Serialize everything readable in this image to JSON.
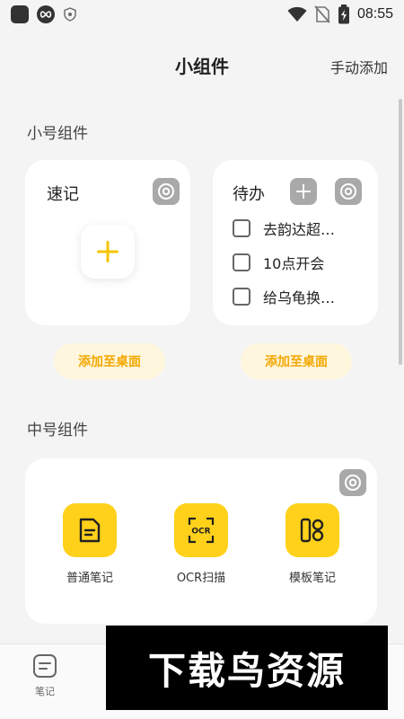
{
  "status_bar": {
    "time": "08:55",
    "icons": [
      "app-icon",
      "infinity-icon",
      "shield-icon",
      "wifi-icon",
      "no-sim-icon",
      "battery-charging-icon"
    ]
  },
  "header": {
    "title": "小组件",
    "manual_add_label": "手动添加"
  },
  "small_section": {
    "title": "小号组件",
    "quick_note_card": {
      "title": "速记",
      "icons": [
        "settings-icon",
        "plus-icon"
      ],
      "add_button_label": "添加至桌面"
    },
    "todo_card": {
      "title": "待办",
      "icons": [
        "plus-icon",
        "settings-icon"
      ],
      "items": [
        {
          "text": "去韵达超…",
          "checked": false
        },
        {
          "text": "10点开会",
          "checked": false
        },
        {
          "text": "给乌龟换…",
          "checked": false
        }
      ],
      "add_button_label": "添加至桌面"
    }
  },
  "medium_section": {
    "title": "中号组件",
    "tools": [
      {
        "label": "普通笔记",
        "icon": "note-icon"
      },
      {
        "label": "OCR扫描",
        "icon": "ocr-scan-icon"
      },
      {
        "label": "模板笔记",
        "icon": "template-icon"
      }
    ],
    "icon_text": {
      "ocr": "OCR"
    }
  },
  "bottom_nav": {
    "items": [
      {
        "label": "笔记",
        "icon": "note-tab-icon"
      }
    ]
  },
  "watermark": {
    "text": "下载鸟资源"
  },
  "colors": {
    "accent_yellow": "#ffd11a",
    "plus_yellow": "#f5c400",
    "pill_background": "#fff6de",
    "pill_text": "#f2a800",
    "icon_gray": "#a9a9a9",
    "background": "#f4f4f4"
  }
}
